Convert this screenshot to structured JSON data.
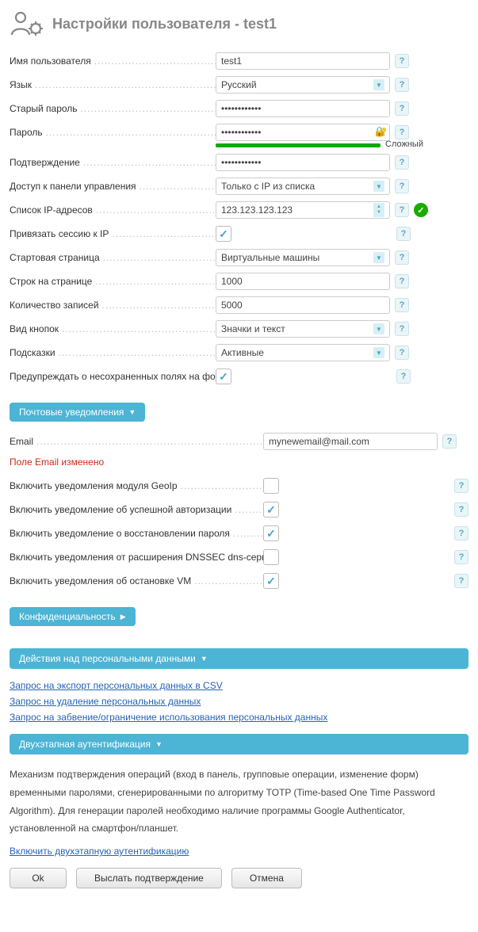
{
  "header": {
    "title": "Настройки пользователя - test1"
  },
  "fields": {
    "username": {
      "label": "Имя пользователя",
      "value": "test1"
    },
    "language": {
      "label": "Язык",
      "value": "Русский"
    },
    "old_password": {
      "label": "Старый пароль",
      "value": "••••••••••••"
    },
    "password": {
      "label": "Пароль",
      "value": "••••••••••••",
      "strength_label": "Сложный"
    },
    "confirm": {
      "label": "Подтверждение",
      "value": "••••••••••••"
    },
    "panel_access": {
      "label": "Доступ к панели управления",
      "value": "Только с IP из списка"
    },
    "ip_list": {
      "label": "Список IP-адресов",
      "value": "123.123.123.123"
    },
    "bind_session_ip": {
      "label": "Привязать сессию к IP",
      "checked": true
    },
    "start_page": {
      "label": "Стартовая страница",
      "value": "Виртуальные машины"
    },
    "rows_per_page": {
      "label": "Строк на странице",
      "value": "1000"
    },
    "records_count": {
      "label": "Количество записей",
      "value": "5000"
    },
    "buttons_style": {
      "label": "Вид кнопок",
      "value": "Значки и текст"
    },
    "hints": {
      "label": "Подсказки",
      "value": "Активные"
    },
    "warn_unsaved": {
      "label": "Предупреждать о несохраненных полях на форме",
      "checked": true
    }
  },
  "sections": {
    "mail": "Почтовые уведомления",
    "privacy": "Конфиденциальность",
    "personal_data": "Действия над персональными данными",
    "twofa": "Двухэтапная аутентификация"
  },
  "mail": {
    "email_label": "Email",
    "email_value": "mynewemail@mail.com",
    "changed_notice": "Поле Email изменено",
    "notifications": [
      {
        "label": "Включить уведомления модуля GeoIp",
        "checked": false
      },
      {
        "label": "Включить уведомление об успешной авторизации",
        "checked": true
      },
      {
        "label": "Включить уведомление о восстановлении пароля",
        "checked": true
      },
      {
        "label": "Включить уведомления от расширения DNSSEC dns-сервера",
        "checked": false
      },
      {
        "label": "Включить уведомления об остановке VM",
        "checked": true
      }
    ]
  },
  "personal_data_links": [
    "Запрос на экспорт персональных данных в CSV",
    "Запрос на удаление персональных данных",
    "Запрос на забвение/ограничение использования персональных данных"
  ],
  "twofa": {
    "paragraph": "Механизм подтверждения операций (вход в панель, групповые операции, изменение форм) временными паролями, сгенерированными по алгоритму TOTP (Time-based One Time Password Algorithm). Для генерации паролей необходимо наличие программы Google Authenticator, установленной на смартфон/планшет.",
    "enable_link": "Включить двухэтапную аутентификацию"
  },
  "buttons": {
    "ok": "Ok",
    "send_confirm": "Выслать подтверждение",
    "cancel": "Отмена"
  }
}
